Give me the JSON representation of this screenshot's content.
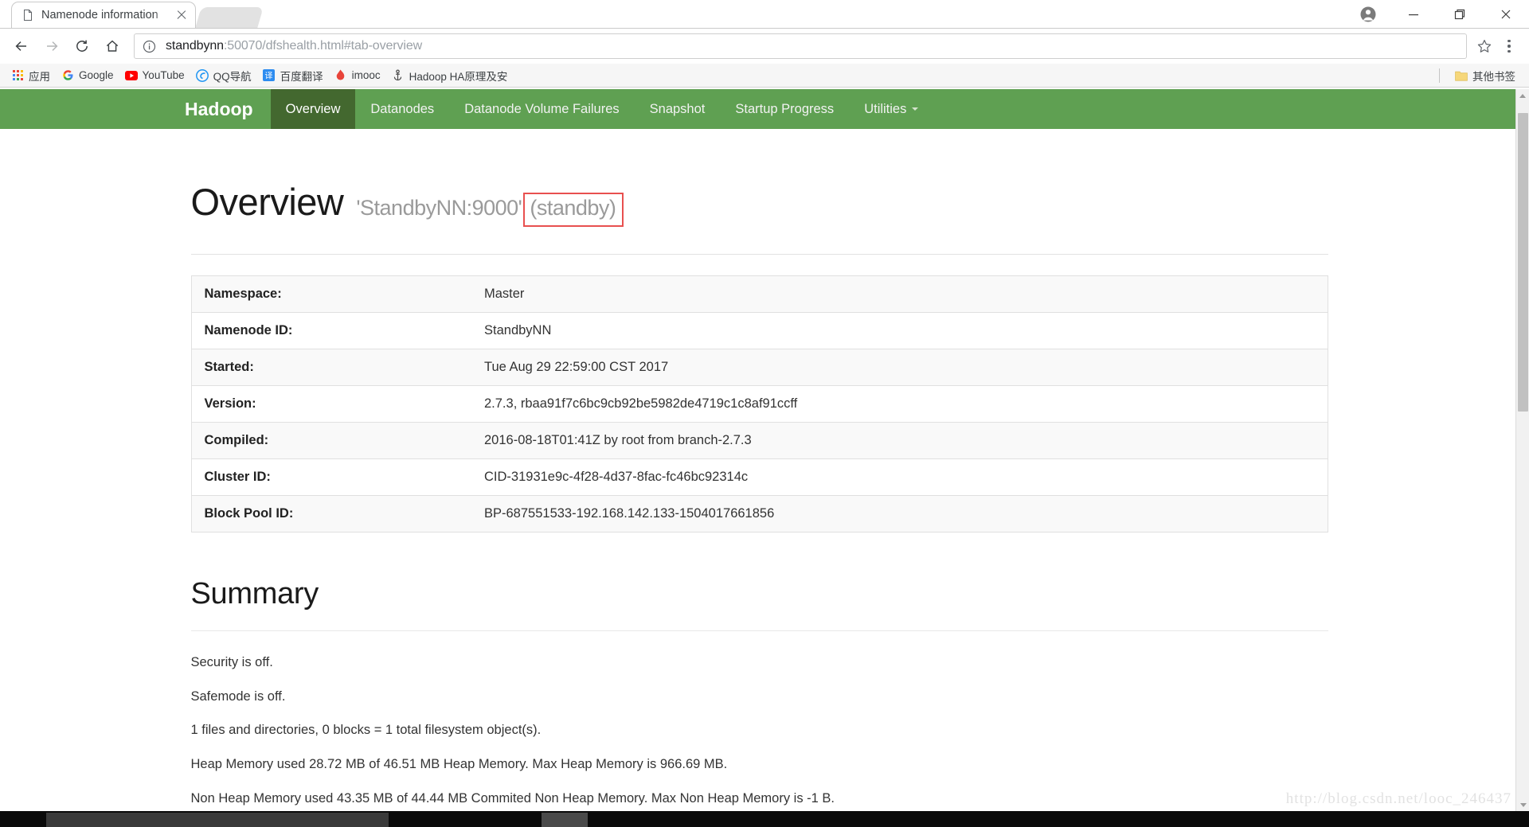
{
  "browser": {
    "tab": {
      "title": "Namenode information",
      "favicon_icon": "document-icon",
      "close_icon": "close-icon"
    },
    "new_tab_icon": "new-tab-ghost",
    "window_controls": {
      "profile_icon": "account-circle-icon",
      "minimize_icon": "minimize-icon",
      "maximize_icon": "restore-window-icon",
      "close_icon": "close-window-icon"
    },
    "toolbar": {
      "back_icon": "back-arrow-icon",
      "forward_icon": "forward-arrow-icon",
      "reload_icon": "reload-icon",
      "home_icon": "home-icon",
      "info_icon": "page-info-icon",
      "url_host": "standbynn",
      "url_path": ":50070/dfshealth.html#tab-overview",
      "url_full": "standbynn:50070/dfshealth.html#tab-overview",
      "star_icon": "bookmark-star-icon",
      "menu_icon": "three-dot-menu-icon"
    },
    "bookmarks": {
      "apps_label": "应用",
      "apps_icon": "apps-grid-icon",
      "items": [
        {
          "label": "Google",
          "icon": "google-icon"
        },
        {
          "label": "YouTube",
          "icon": "youtube-icon"
        },
        {
          "label": "QQ导航",
          "icon": "qq-browser-icon"
        },
        {
          "label": "百度翻译",
          "icon": "baidu-translate-icon"
        },
        {
          "label": "imooc",
          "icon": "imooc-flame-icon"
        },
        {
          "label": "Hadoop HA原理及安",
          "icon": "anchor-icon"
        }
      ],
      "other_label": "其他书签",
      "other_icon": "folder-icon"
    },
    "scrollbar": {
      "up_icon": "scroll-up-arrow-icon",
      "down_icon": "scroll-down-arrow-icon"
    }
  },
  "colors": {
    "navbar_green": "#5fa052",
    "navbar_active_green": "#43682f",
    "annotation_red": "#e8504f"
  },
  "navbar": {
    "brand": "Hadoop",
    "links": [
      {
        "label": "Overview",
        "active": true
      },
      {
        "label": "Datanodes",
        "active": false
      },
      {
        "label": "Datanode Volume Failures",
        "active": false
      },
      {
        "label": "Snapshot",
        "active": false
      },
      {
        "label": "Startup Progress",
        "active": false
      }
    ],
    "dropdown": {
      "label": "Utilities",
      "caret_icon": "caret-down-icon"
    }
  },
  "overview": {
    "title": "Overview",
    "address": "'StandbyNN:9000'",
    "state": "(standby)",
    "table": [
      {
        "key": "Namespace:",
        "value": "Master"
      },
      {
        "key": "Namenode ID:",
        "value": "StandbyNN"
      },
      {
        "key": "Started:",
        "value": "Tue Aug 29 22:59:00 CST 2017"
      },
      {
        "key": "Version:",
        "value": "2.7.3, rbaa91f7c6bc9cb92be5982de4719c1c8af91ccff"
      },
      {
        "key": "Compiled:",
        "value": "2016-08-18T01:41Z by root from branch-2.7.3"
      },
      {
        "key": "Cluster ID:",
        "value": "CID-31931e9c-4f28-4d37-8fac-fc46bc92314c"
      },
      {
        "key": "Block Pool ID:",
        "value": "BP-687551533-192.168.142.133-1504017661856"
      }
    ]
  },
  "summary": {
    "heading": "Summary",
    "lines": [
      "Security is off.",
      "Safemode is off.",
      "1 files and directories, 0 blocks = 1 total filesystem object(s).",
      "Heap Memory used 28.72 MB of 46.51 MB Heap Memory. Max Heap Memory is 966.69 MB.",
      "Non Heap Memory used 43.35 MB of 44.44 MB Commited Non Heap Memory. Max Non Heap Memory is -1 B."
    ]
  },
  "watermark": "http://blog.csdn.net/looc_246437",
  "taskbar": {
    "clock": ""
  }
}
